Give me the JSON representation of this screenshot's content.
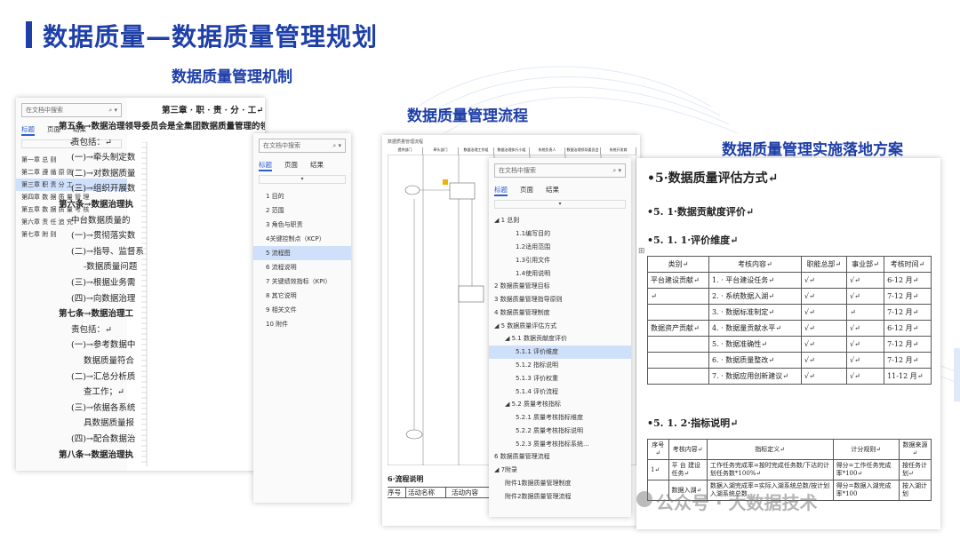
{
  "title": "数据质量—数据质量管理规划",
  "captions": {
    "mechanism": "数据质量管理机制",
    "process": "数据质量管理流程",
    "plan": "数据质量管理实施落地方案"
  },
  "nav_common": {
    "search_placeholder": "在文档中搜索",
    "tab_headings": "标题",
    "tab_pages": "页面",
    "tab_results": "结果"
  },
  "panel1": {
    "nav_items": [
      "第一章 总 则",
      "第二章 遵 循 原 则",
      "第三章 职 责 分 工",
      "第四章 数 据 质 量 管 理",
      "第五章 数 据 质 量 考 核",
      "第六章 责 任 追 究",
      "第七章 附 则"
    ],
    "selected": 2,
    "doc_lines": [
      "第三章 · 职 · 责 · 分 · 工↵",
      "第五条→数据治理领导委员会是全集团数据质量管理的领导组织，主要职",
      "责包括：↵",
      "(一)→牵头制定数",
      "(二)→对数据质量",
      "(三)→组织开展数",
      "第六条→数据治理执",
      "中台数据质量的",
      "(一)→贯彻落实数",
      "(二)→指导、监督系",
      "-数据质量问题",
      "(三)→根据业务需",
      "(四)→向数据治理",
      "第七条→数据治理工",
      "责包括：↵",
      "(一)→参考数据中",
      "数据质量符合",
      "(二)→汇总分析质",
      "查工作；↵",
      "(三)→依据各系统",
      "具数据质量报",
      "(四)→配合数据治",
      "第八条→数据治理执"
    ]
  },
  "panel2": {
    "nav_items": [
      "1 目的",
      "2 范围",
      "3 角色与职责",
      "4关键控制点（KCP）",
      "5 流程图",
      "6 流程说明",
      "7 关键绩效指标（KPI）",
      "8 其它说明",
      "9 相关文件",
      "10 附件"
    ],
    "selected": 4
  },
  "panel3": {
    "flow_header": "数据质量管理流程",
    "lanes": [
      "提供部门",
      "牵头部门",
      "数据治理工作组",
      "数据治理执行小组",
      "系统负责人",
      "数据治理领导委员会",
      "系统开发商"
    ],
    "footer_label": "6·流程说明",
    "footer_cols": [
      "序号",
      "活动名称",
      "活动内容"
    ]
  },
  "panel4": {
    "nav_items": [
      {
        "t": "◢ 1 总则",
        "lv": 0
      },
      {
        "t": "1.1编写目的",
        "lv": 2
      },
      {
        "t": "1.2适用范围",
        "lv": 2
      },
      {
        "t": "1.3引用文件",
        "lv": 2
      },
      {
        "t": "1.4使用说明",
        "lv": 2
      },
      {
        "t": "2 数据质量管理目标",
        "lv": 0
      },
      {
        "t": "3 数据质量管理指导原则",
        "lv": 0
      },
      {
        "t": "4 数据质量管理制度",
        "lv": 0
      },
      {
        "t": "◢ 5 数据质量评估方式",
        "lv": 0
      },
      {
        "t": "◢ 5.1 数据贡献度评价",
        "lv": 1
      },
      {
        "t": "5.1.1 评价维度",
        "lv": 2
      },
      {
        "t": "5.1.2 指标说明",
        "lv": 2
      },
      {
        "t": "5.1.3 评价权重",
        "lv": 2
      },
      {
        "t": "5.1.4 评价流程",
        "lv": 2
      },
      {
        "t": "◢ 5.2 质量考核指标",
        "lv": 1
      },
      {
        "t": "5.2.1 质量考核指标维度",
        "lv": 2
      },
      {
        "t": "5.2.2 质量考核指标说明",
        "lv": 2
      },
      {
        "t": "5.2.3 质量考核指标系统...",
        "lv": 2
      },
      {
        "t": "6 数据质量管理流程",
        "lv": 0
      },
      {
        "t": "◢ 7附录",
        "lv": 0
      },
      {
        "t": "附件1数据质量管理制度",
        "lv": 1
      },
      {
        "t": "附件2数据质量管理流程",
        "lv": 1
      }
    ],
    "selected": 10
  },
  "panel5": {
    "h1": "•5·数据质量评估方式↵",
    "h2": "•5. 1·数据贡献度评价↵",
    "h3": "•5. 1. 1·评价维度↵",
    "table_header": [
      "类别↵",
      "考核内容↵",
      "职能总部↵",
      "事业部↵",
      "考核时间↵"
    ],
    "table_rows": [
      [
        "平台建设贡献↵",
        "1. · 平台建设任务↵",
        "√↵",
        "√↵",
        "6-12 月↵"
      ],
      [
        "↵",
        "2. · 系统数据入湖↵",
        "√↵",
        "√↵",
        "7-12 月↵"
      ],
      [
        "",
        "3. · 数据标准制定↵",
        "√↵",
        "↵",
        "7-12 月↵"
      ],
      [
        "数据资产贡献↵",
        "4. · 数据量贡献水平↵",
        "√↵",
        "√↵",
        "6-12 月↵"
      ],
      [
        "",
        "5. · 数据准确性↵",
        "√↵",
        "√↵",
        "7-12 月↵"
      ],
      [
        "",
        "6. · 数据质量整改↵",
        "√↵",
        "√↵",
        "7-12 月↵"
      ],
      [
        "",
        "7. · 数据应用创新建议↵",
        "√↵",
        "√↵",
        "11-12 月↵"
      ]
    ],
    "h4": "•5. 1. 2·指标说明↵",
    "t2_header": [
      "序号↵",
      "考核内容↵",
      "指标定义↵",
      "计分规则↵",
      "数据来源↵"
    ],
    "t2_row1": [
      "1↵",
      "平 台 建设任务↵",
      "工作任务完成率=按时完成任务数/下达的计划任务数*100%↵",
      "得分=工作任务完成率*100↵",
      "按任务计划↵"
    ],
    "t2_row2": [
      "",
      "数据入湖↵",
      "数据入湖完成率=实际入湖系统总数/按计划入湖系统总数",
      "得分=数据入湖完成率*100",
      "按入湖计划"
    ]
  },
  "watermark": "公众号 · 大数据技术"
}
